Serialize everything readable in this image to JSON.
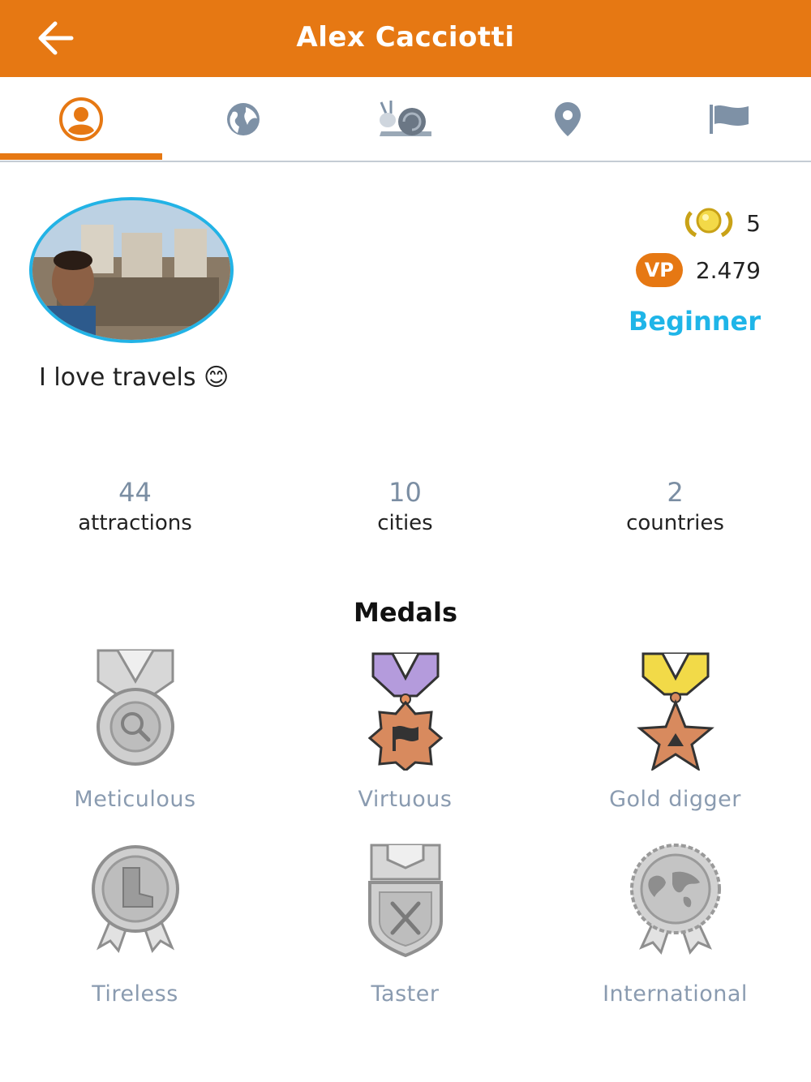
{
  "header": {
    "title": "Alex Cacciotti",
    "back_icon": "arrow-left-icon"
  },
  "tabs": [
    {
      "icon": "user-icon",
      "active": true
    },
    {
      "icon": "globe-icon",
      "active": false
    },
    {
      "icon": "snail-icon",
      "active": false
    },
    {
      "icon": "map-pin-icon",
      "active": false
    },
    {
      "icon": "flag-icon",
      "active": false
    }
  ],
  "profile": {
    "crowns": "5",
    "vp_badge": "VP",
    "vp_points": "2.479",
    "level": "Beginner",
    "bio": "I love travels 😊"
  },
  "counts": [
    {
      "value": "44",
      "label": "attractions"
    },
    {
      "value": "10",
      "label": "cities"
    },
    {
      "value": "2",
      "label": "countries"
    }
  ],
  "medals": {
    "title": "Medals",
    "items": [
      {
        "label": "Meticulous",
        "earned": false
      },
      {
        "label": "Virtuous",
        "earned": true
      },
      {
        "label": "Gold digger",
        "earned": true
      },
      {
        "label": "Tireless",
        "earned": false
      },
      {
        "label": "Taster",
        "earned": false
      },
      {
        "label": "International",
        "earned": false
      }
    ]
  },
  "colors": {
    "brand": "#e67813",
    "accent": "#1fb5e8",
    "muted": "#8a9bb0"
  }
}
